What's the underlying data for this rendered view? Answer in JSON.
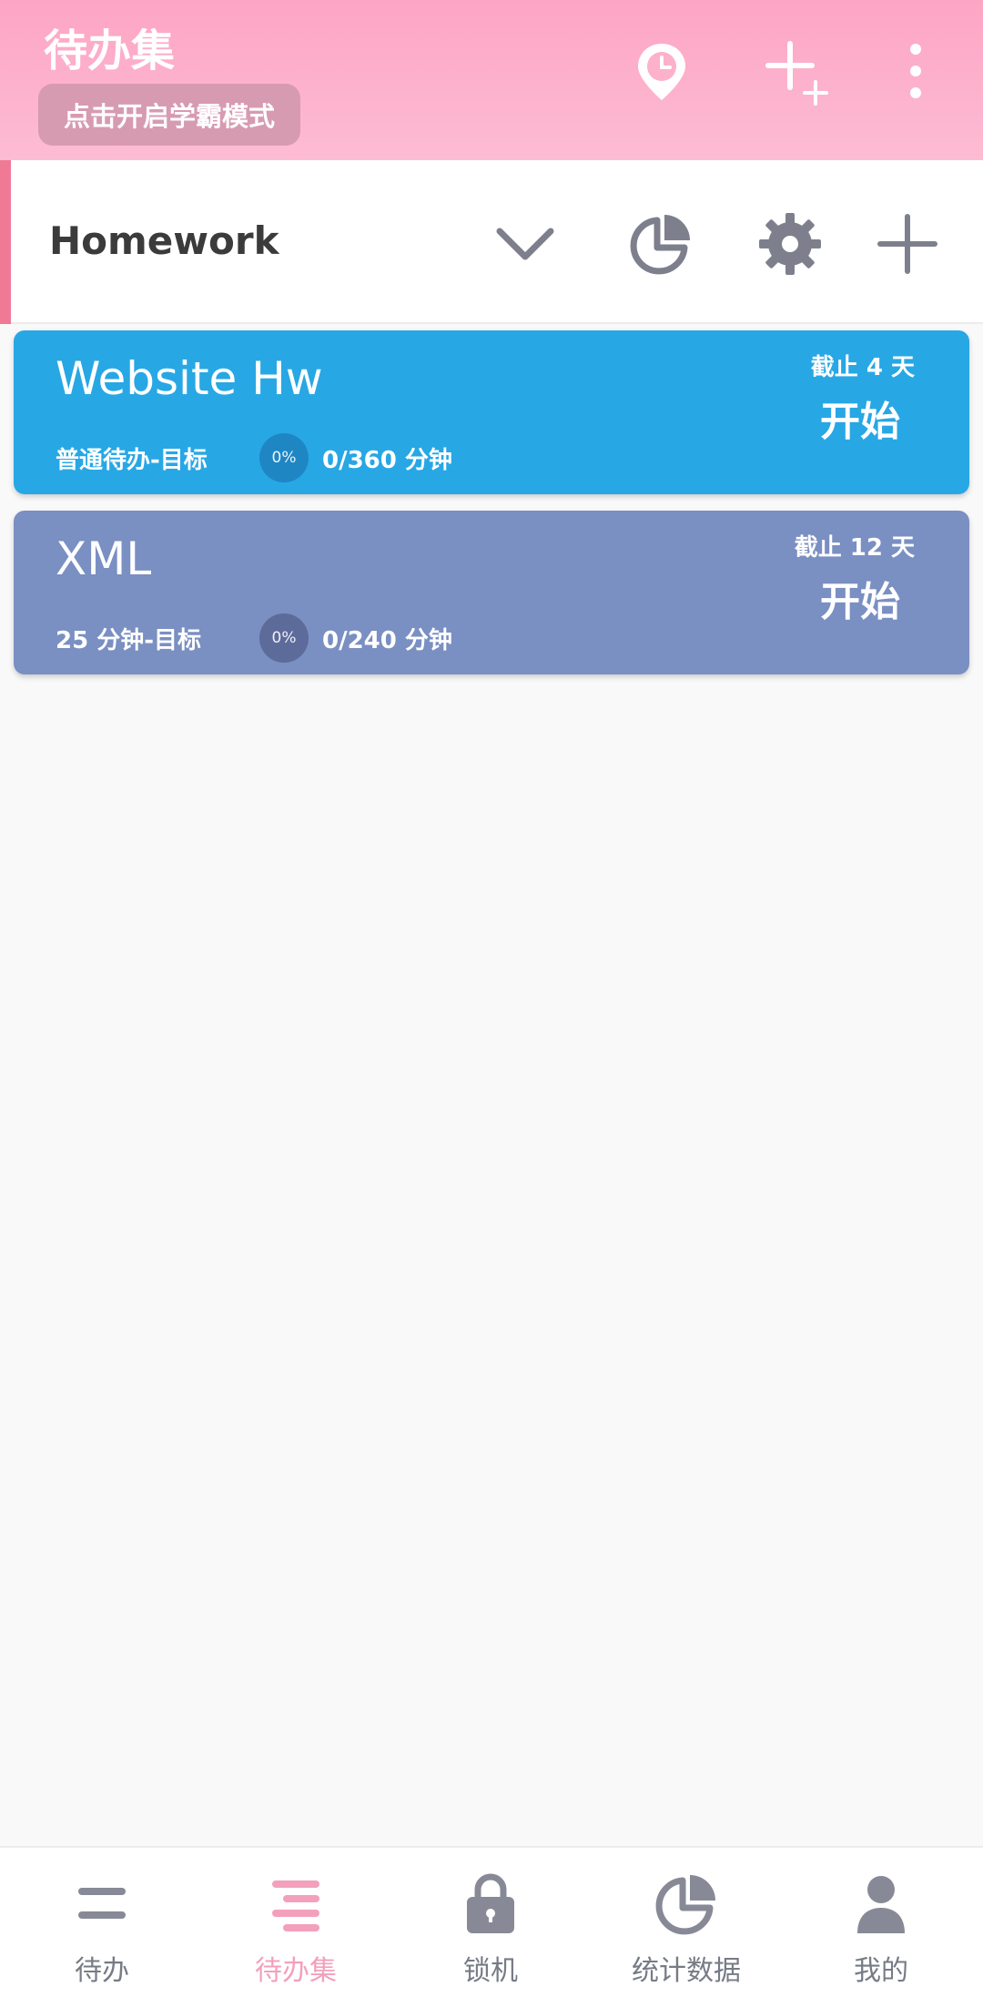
{
  "header": {
    "title": "待办集",
    "mode_button": "点击开启学霸模式",
    "icons": [
      "location-clock-icon",
      "add-multiple-icon",
      "more-vert-icon"
    ]
  },
  "group": {
    "name": "Homework",
    "icons": [
      "chevron-down-icon",
      "pie-chart-icon",
      "gear-icon",
      "plus-icon"
    ],
    "accent_color": "#f07a96"
  },
  "tasks": [
    {
      "name": "Website Hw",
      "type": "普通待办-目标",
      "percent": "0%",
      "progress": "0/360  分钟",
      "deadline": "截止 4 天",
      "start": "开始",
      "color": "#28a7e5"
    },
    {
      "name": "XML",
      "type": "25 分钟-目标",
      "percent": "0%",
      "progress": "0/240  分钟",
      "deadline": "截止 12 天",
      "start": "开始",
      "color": "#7a8fc2"
    }
  ],
  "nav": {
    "items": [
      {
        "label": "待办",
        "icon": "list-icon"
      },
      {
        "label": "待办集",
        "icon": "list-set-icon",
        "active": true
      },
      {
        "label": "锁机",
        "icon": "lock-icon"
      },
      {
        "label": "统计数据",
        "icon": "pie-chart-icon"
      },
      {
        "label": "我的",
        "icon": "person-icon"
      }
    ],
    "active_color": "#f3a0bc",
    "inactive_color": "#878a96"
  }
}
